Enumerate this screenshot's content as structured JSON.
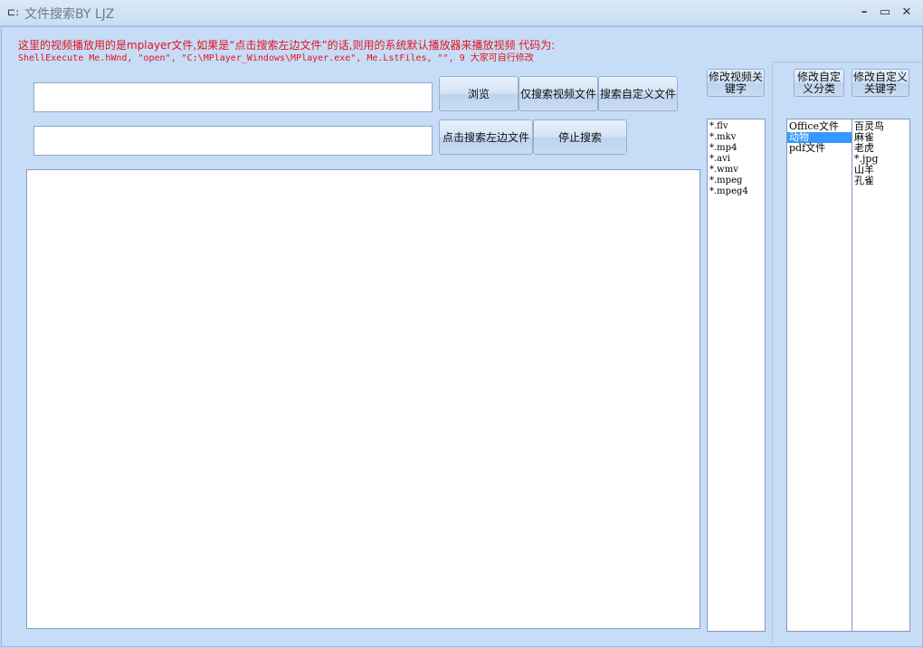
{
  "window": {
    "title": "文件搜索BY LJZ",
    "min": "–",
    "max": "▭",
    "close": "✕"
  },
  "notes": {
    "line1": "这里的视频播放用的是mplayer文件,如果是“点击搜索左边文件”的话,则用的系统默认播放器来播放视频 代码为:",
    "line2": "ShellExecute Me.hWnd, \"open\", \"C:\\MPlayer_Windows\\MPlayer.exe\", Me.LstFiles, \"\", 9 大家可自行修改"
  },
  "inputs": {
    "path_value": "",
    "second_value": ""
  },
  "buttons": {
    "browse": "浏览",
    "video_only": "仅搜索视频文件",
    "custom_search": "搜索自定义文件",
    "click_search_left": "点击搜索左边文件",
    "stop": "停止搜索",
    "edit_video_kw": "修改视频关键字",
    "edit_category": "修改自定义分类",
    "edit_custom_kw": "修改自定义关键字"
  },
  "video_keywords": [
    "*.flv",
    "*.mkv",
    "*.mp4",
    "*.avi",
    "*.wmv",
    "*.mpeg",
    "*.mpeg4"
  ],
  "categories": [
    {
      "label": "Office文件",
      "selected": false
    },
    {
      "label": "动物",
      "selected": true
    },
    {
      "label": "pdf文件",
      "selected": false
    }
  ],
  "custom_keywords": [
    "百灵鸟",
    "麻雀",
    "老虎",
    "*.jpg",
    "山羊",
    "孔雀"
  ]
}
